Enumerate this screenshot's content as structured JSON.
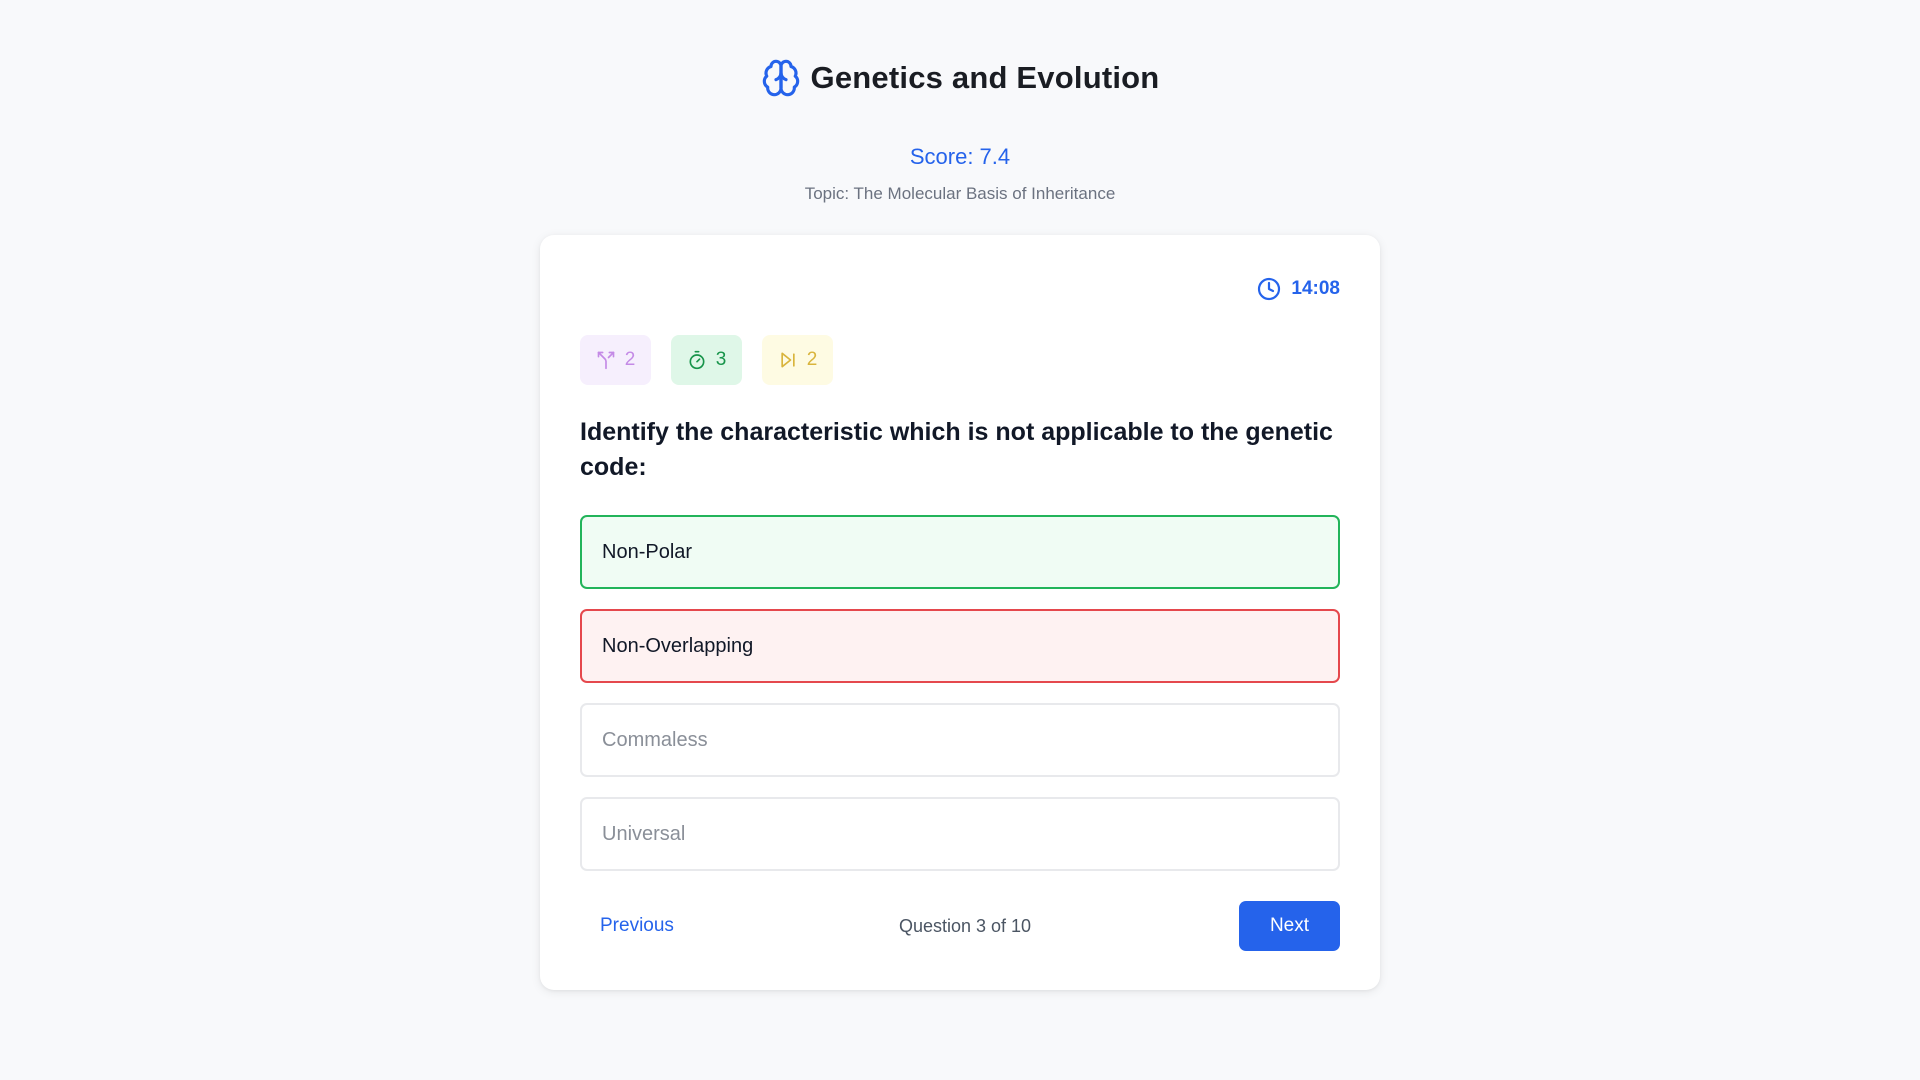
{
  "header": {
    "title": "Genetics and Evolution",
    "icon": "brain-icon"
  },
  "score_text": "Score: 7.4",
  "topic_text": "Topic: The Molecular Basis of Inheritance",
  "timer": {
    "icon": "clock-icon",
    "value": "14:08"
  },
  "lifelines": [
    {
      "icon": "split-icon",
      "count": "2",
      "color": "#c48ae6"
    },
    {
      "icon": "stopwatch-icon",
      "count": "3",
      "color": "#17944a"
    },
    {
      "icon": "skip-icon",
      "count": "2",
      "color": "#d9b43c"
    }
  ],
  "question": "Identify the characteristic which is not applicable to the genetic code:",
  "options": [
    {
      "label": "Non-Polar",
      "state": "correct"
    },
    {
      "label": "Non-Overlapping",
      "state": "wrong"
    },
    {
      "label": "Commaless",
      "state": "neutral"
    },
    {
      "label": "Universal",
      "state": "neutral"
    }
  ],
  "footer": {
    "previous_label": "Previous",
    "progress_text": "Question 3 of 10",
    "next_label": "Next"
  },
  "colors": {
    "accent": "#2563eb",
    "correct": "#22b45a",
    "wrong": "#e5484d"
  }
}
